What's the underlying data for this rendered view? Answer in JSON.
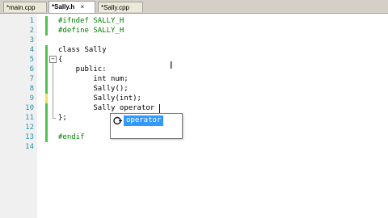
{
  "tabs": [
    {
      "label": "*main.cpp",
      "active": false
    },
    {
      "label": "*Sally.h",
      "active": true,
      "close": "×"
    },
    {
      "label": "*Sally.cpp",
      "active": false
    }
  ],
  "lines": [
    {
      "n": "1",
      "code": "#ifndef SALLY_H"
    },
    {
      "n": "2",
      "code": "#define SALLY_H"
    },
    {
      "n": "3",
      "code": ""
    },
    {
      "n": "4",
      "code": "class Sally"
    },
    {
      "n": "5",
      "code": "{"
    },
    {
      "n": "6",
      "code": "    public:"
    },
    {
      "n": "7",
      "code": "        int num;"
    },
    {
      "n": "8",
      "code": "        Sally();"
    },
    {
      "n": "9",
      "code": "        Sally(int);"
    },
    {
      "n": "10",
      "code": "        Sally operator"
    },
    {
      "n": "11",
      "code": "};"
    },
    {
      "n": "12",
      "code": ""
    },
    {
      "n": "13",
      "code": "#endif"
    },
    {
      "n": "14",
      "code": ""
    }
  ],
  "fold": {
    "open": "−"
  },
  "autocomplete": {
    "icon": "🌀",
    "icon_name": "method-icon",
    "item": "operator"
  },
  "colors": {
    "preprocessor": "#008000",
    "line_number": "#2b91af",
    "changed_green": "#4fc24f",
    "changed_yellow": "#f0e060",
    "selection": "#3399ff"
  }
}
